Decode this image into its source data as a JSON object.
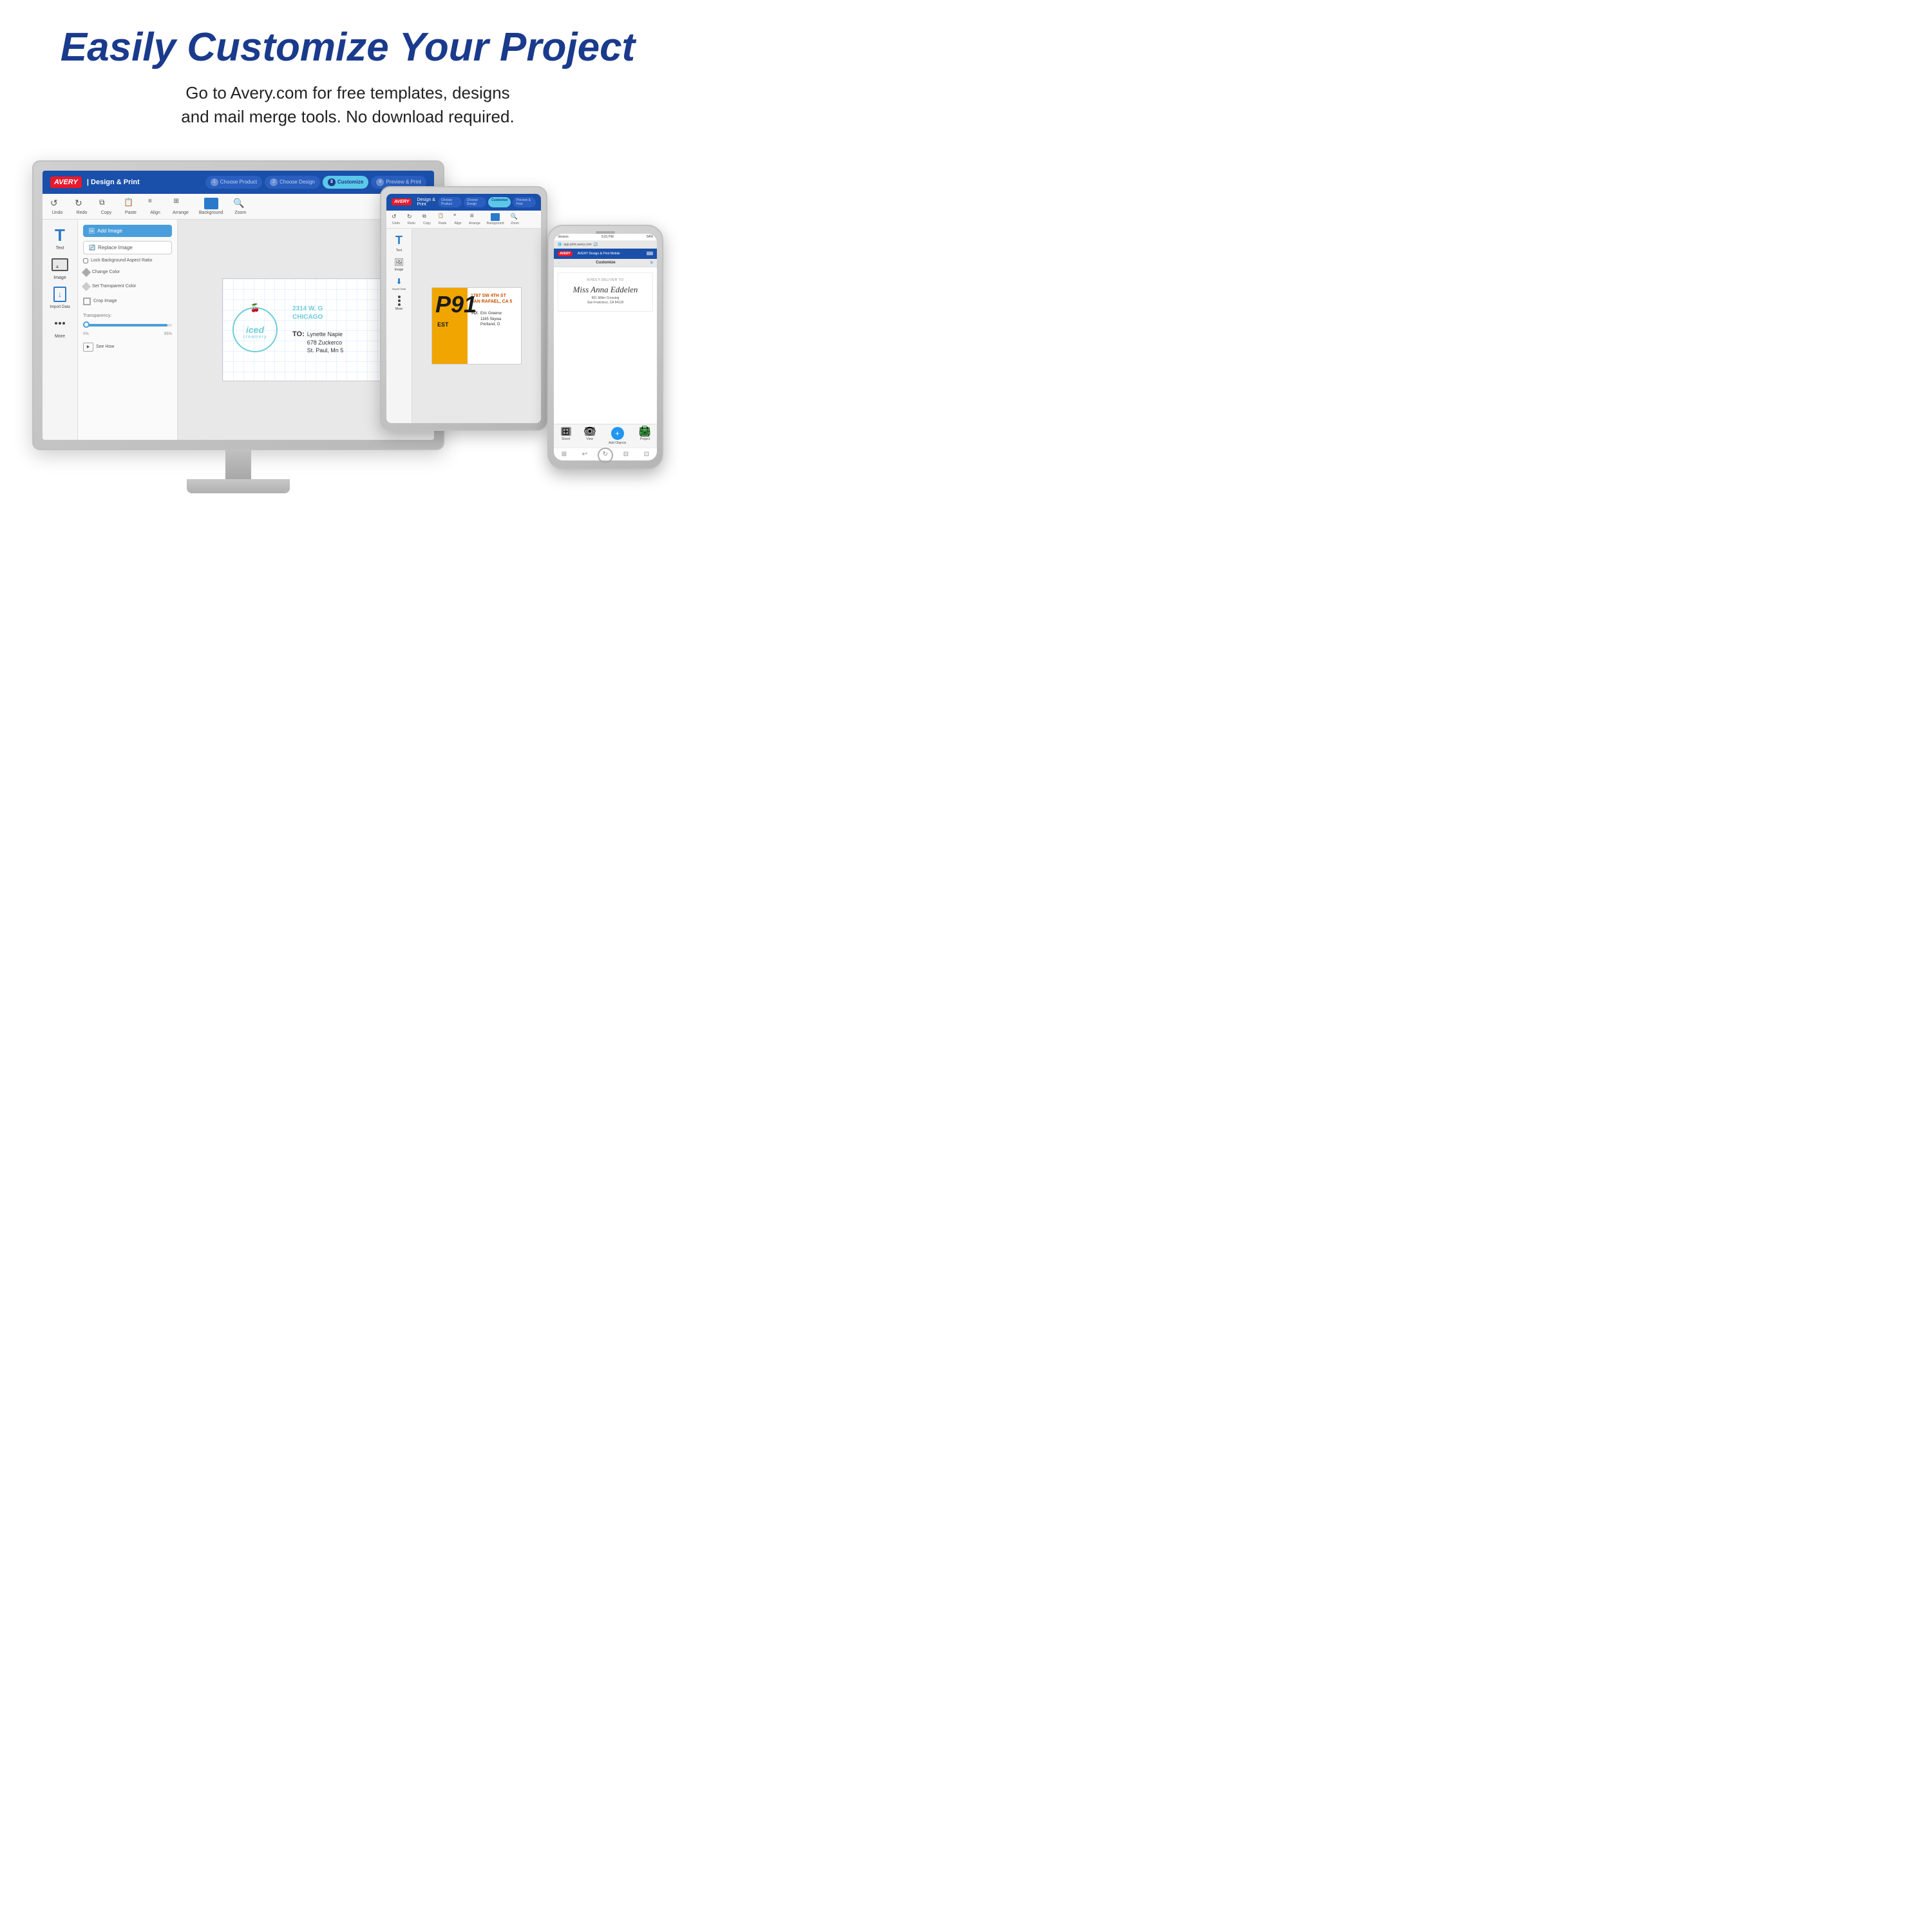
{
  "header": {
    "title": "Easily Customize Your Project",
    "subtitle_line1": "Go to Avery.com for free templates, designs",
    "subtitle_line2": "and mail merge tools. No download required."
  },
  "avery_app": {
    "logo": "AVERY",
    "logo_separator": "|",
    "app_name": "Design & Print",
    "steps": [
      {
        "num": "1",
        "label": "Choose Product"
      },
      {
        "num": "2",
        "label": "Choose Design"
      },
      {
        "num": "3",
        "label": "Customize",
        "active": true
      },
      {
        "num": "4",
        "label": "Preview & Print"
      }
    ],
    "toolbar": {
      "items": [
        "Undo",
        "Redo",
        "Copy",
        "Paste",
        "Align",
        "Arrange",
        "Background",
        "Zoom"
      ]
    },
    "sidebar_tools": [
      {
        "label": "Text",
        "type": "text"
      },
      {
        "label": "Image",
        "type": "image"
      },
      {
        "label": "Import Data",
        "type": "import"
      },
      {
        "label": "More",
        "type": "more"
      }
    ],
    "options_panel": {
      "add_image": "Add Image",
      "replace_image": "Replace Image",
      "lock_bg": "Lock Background Aspect Ratio",
      "change_color": "Change Color",
      "set_transparent": "Set Transparent Color",
      "crop_image": "Crop Image",
      "transparency_label": "Transparency:",
      "transparency_min": "0%",
      "transparency_max": "95%",
      "see_how": "See How"
    },
    "label": {
      "logo_text1": "iced",
      "logo_text2": "creamery",
      "address_line1": "2314 W. G",
      "address_line2": "CHICAGO",
      "to_label": "TO:",
      "to_name": "Lynette Napie",
      "to_address1": "678 Zuckerco",
      "to_address2": "St. Paul, Mn 5"
    }
  },
  "tablet": {
    "label_number": "P91",
    "label_est": "EST",
    "label_address": "1787 SW 4TH ST\nSAN RAFAEL, CA 5",
    "to_label": "TO:",
    "to_name": "Eric Greenw",
    "to_addr1": "1165 Skywa",
    "to_addr2": "Portland, O",
    "more_label": "More"
  },
  "phone": {
    "status": "Verizon",
    "time": "5:01 PM",
    "battery": "54%",
    "url": "app.print.avery.com",
    "app_name": "AVERY Design & Print Mobile",
    "sub_title": "Customize",
    "back": "←",
    "kindly": "KINDLY DELIVER TO",
    "name": "Miss Anna Eddelen",
    "address_line1": "901 Miller Crossing",
    "address_line2": "San Francisco, CA 94118",
    "bottom_items": [
      "Sheet",
      "View",
      "Add Objects",
      "Project"
    ],
    "nav_icons": [
      "⊞",
      "↩",
      "↻",
      "⊟",
      "⊡"
    ]
  }
}
